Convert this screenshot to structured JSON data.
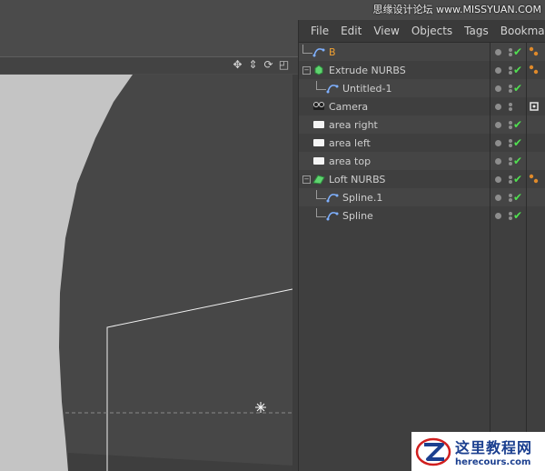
{
  "menu": {
    "items": [
      "File",
      "Edit",
      "View",
      "Objects",
      "Tags",
      "Bookmarks"
    ]
  },
  "objects": [
    {
      "label": "B",
      "indent": 0,
      "expander": "",
      "icon": "spline-icon",
      "label_color": "#f0a032",
      "tree_line": true,
      "check": true,
      "tags": "phong-tag"
    },
    {
      "label": "Extrude NURBS",
      "indent": 0,
      "expander": "−",
      "icon": "extrude-nurbs-icon",
      "label_color": "#cfcfcf",
      "tree_line": false,
      "check": true,
      "tags": "phong-tag"
    },
    {
      "label": "Untitled-1",
      "indent": 1,
      "expander": "",
      "icon": "spline-icon",
      "label_color": "#cfcfcf",
      "tree_line": true,
      "check": true,
      "tags": ""
    },
    {
      "label": "Camera",
      "indent": 0,
      "expander": "",
      "icon": "camera-icon",
      "label_color": "#cfcfcf",
      "tree_line": false,
      "check": false,
      "tags": "target-tag"
    },
    {
      "label": "area right",
      "indent": 0,
      "expander": "",
      "icon": "light-icon",
      "label_color": "#cfcfcf",
      "tree_line": false,
      "check": true,
      "tags": ""
    },
    {
      "label": "area left",
      "indent": 0,
      "expander": "",
      "icon": "light-icon",
      "label_color": "#cfcfcf",
      "tree_line": false,
      "check": true,
      "tags": ""
    },
    {
      "label": "area top",
      "indent": 0,
      "expander": "",
      "icon": "light-icon",
      "label_color": "#cfcfcf",
      "tree_line": false,
      "check": true,
      "tags": ""
    },
    {
      "label": "Loft NURBS",
      "indent": 0,
      "expander": "−",
      "icon": "loft-nurbs-icon",
      "label_color": "#cfcfcf",
      "tree_line": false,
      "check": true,
      "tags": "phong-tag"
    },
    {
      "label": "Spline.1",
      "indent": 1,
      "expander": "",
      "icon": "spline-icon",
      "label_color": "#cfcfcf",
      "tree_line": true,
      "check": true,
      "tags": ""
    },
    {
      "label": "Spline",
      "indent": 1,
      "expander": "",
      "icon": "spline-icon",
      "label_color": "#cfcfcf",
      "tree_line": true,
      "check": true,
      "tags": ""
    }
  ],
  "viewport": {
    "controls": [
      "move-view-icon",
      "zoom-view-icon",
      "rotate-view-icon",
      "toggle-view-icon"
    ]
  },
  "watermark": {
    "top": "思缘设计论坛 www.MISSYUAN.COM",
    "bottom_cn": "这里教程网",
    "bottom_en": "herecours.com"
  },
  "colors": {
    "accent_orange": "#f0a032",
    "check_green": "#4fe04f",
    "viewport_bg": "#c4c4c4",
    "shape_fill": "#474747"
  }
}
